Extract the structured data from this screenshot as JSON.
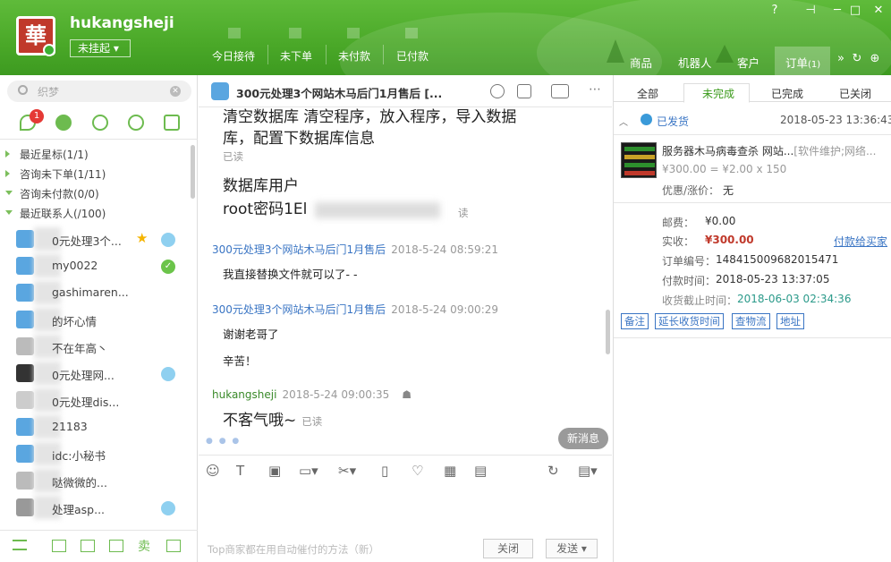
{
  "header": {
    "user_name": "hukangsheji",
    "status_label": "未挂起",
    "logo_char": "華",
    "nav_tabs": [
      "今日接待",
      "未下单",
      "未付款",
      "已付款"
    ],
    "right_tabs": [
      "商品",
      "机器人",
      "客户",
      "订单"
    ],
    "order_count": "(1)"
  },
  "left": {
    "search_placeholder": "织梦",
    "badge_count": "1",
    "groups": [
      {
        "label": "最近星标(1/1)",
        "open": false
      },
      {
        "label": "咨询未下单(1/11)",
        "open": false
      },
      {
        "label": "咨询未付款(0/0)",
        "open": true
      },
      {
        "label": "最近联系人(/100)",
        "open": true
      }
    ],
    "contacts": [
      {
        "name": "0元处理3个...",
        "indicator": "star"
      },
      {
        "name": "my0022",
        "indicator": "check"
      },
      {
        "name": "gashimaren...",
        "indicator": ""
      },
      {
        "name": "的坏心情",
        "indicator": ""
      },
      {
        "name": "不在年高丶",
        "indicator": ""
      },
      {
        "name": "0元处理网...",
        "indicator": "msg"
      },
      {
        "name": "0元处理dis...",
        "indicator": ""
      },
      {
        "name": "21183",
        "indicator": ""
      },
      {
        "name": "idc:小秘书",
        "indicator": ""
      },
      {
        "name": "哒微微的...",
        "indicator": ""
      },
      {
        "name": "处理asp...",
        "indicator": "msg"
      }
    ]
  },
  "chat": {
    "title": "300元处理3个网站木马后门1月售后 [...",
    "messages": [
      {
        "line1": "清空数据库 清空程序，放入程序，导入数据",
        "line2": "库，配置下数据库信息",
        "status": "已读"
      },
      {
        "line1": "数据库用户",
        "line2": "root密码1El",
        "status": "读"
      }
    ],
    "customer_name": "300元处理3个网站木马后门1月售后",
    "m1_time": "2018-5-24 08:59:21",
    "m1_text": "我直接替换文件就可以了- -",
    "m2_time": "2018-5-24 09:00:29",
    "m2_text1": "谢谢老哥了",
    "m2_text2": "辛苦！",
    "me_name": "hukangsheji",
    "me_time": "2018-5-24 09:00:35",
    "me_text": "不客气哦~",
    "me_status": "已读",
    "new_msg": "新消息",
    "hint": "Top商家都在用自动催付的方法（新）",
    "close_btn": "关闭",
    "send_btn": "发送"
  },
  "order": {
    "tabs": [
      "全部",
      "未完成",
      "已完成",
      "已关闭"
    ],
    "status": "已发货",
    "datetime": "2018-05-23 13:36:43",
    "product_title": "服务器木马病毒查杀 网站...",
    "product_tag": "[软件维护;网络...",
    "price_line": "¥300.00 = ¥2.00 x 150",
    "discount_label": "优惠/涨价：",
    "discount_value": "无",
    "postage_label": "邮费：",
    "postage_value": "¥0.00",
    "paid_label": "实收：",
    "paid_value": "¥300.00",
    "pay_link": "付款给买家",
    "order_no_label": "订单编号：",
    "order_no": "148415009682015471",
    "pay_time_label": "付款时间：",
    "pay_time": "2018-05-23 13:37:05",
    "deadline_label": "收货截止时间：",
    "deadline": "2018-06-03 02:34:36",
    "actions": [
      "备注",
      "延长收货时间",
      "查物流",
      "地址"
    ],
    "img_lines": [
      "服务器木马查杀",
      "网站 后门 挂马",
      "后门清理 防护",
      "漏洞修复"
    ]
  }
}
